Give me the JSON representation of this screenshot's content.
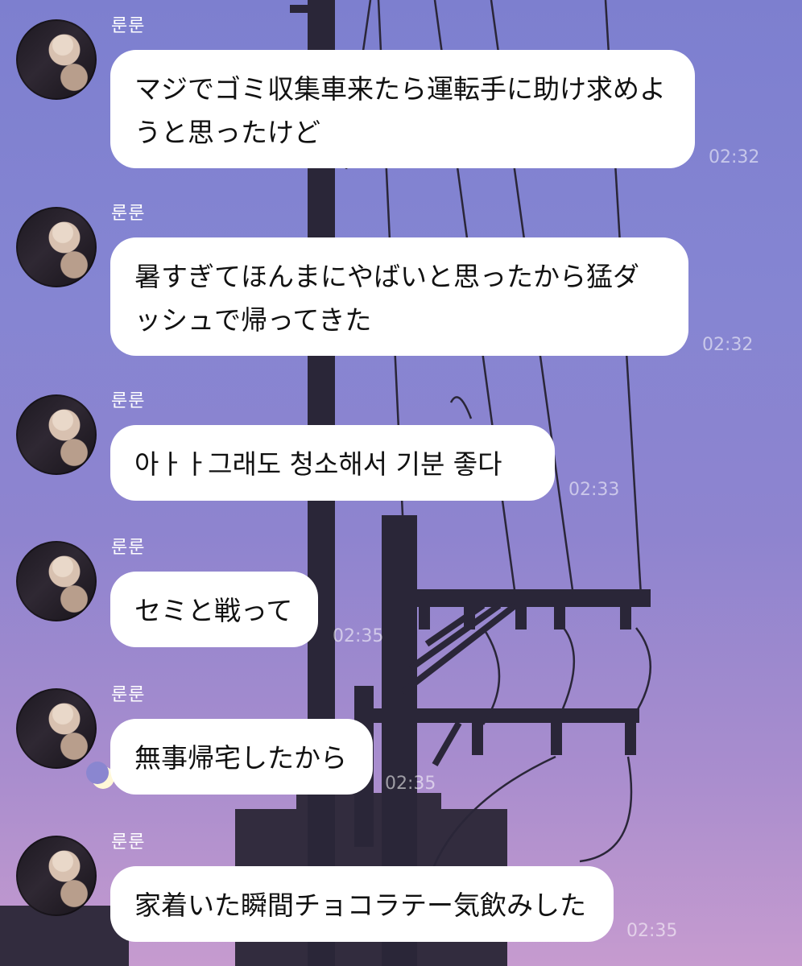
{
  "chat": {
    "messages": [
      {
        "sender": "룬룬",
        "text": "マジでゴミ収集車来たら運転手に助け求めようと思ったけど",
        "time": "02:32"
      },
      {
        "sender": "룬룬",
        "text": "暑すぎてほんまにやばいと思ったから猛ダッシュで帰ってきた",
        "time": "02:32"
      },
      {
        "sender": "룬룬",
        "text": "아ㅏㅏ그래도 청소해서 기분 좋다",
        "time": "02:33"
      },
      {
        "sender": "룬룬",
        "text": "セミと戦って",
        "time": "02:35"
      },
      {
        "sender": "룬룬",
        "text": "無事帰宅したから",
        "time": "02:35"
      },
      {
        "sender": "룬룬",
        "text": "家着いた瞬間チョコラテー気飲みした",
        "time": "02:35"
      }
    ]
  },
  "colors": {
    "sky_top": "#7d7fcf",
    "sky_bottom": "#c69bcf",
    "bubble": "#ffffff",
    "silhouette": "#2a2638"
  },
  "icons": {
    "avatar": "profile-photo-icon",
    "moon": "crescent-moon-icon"
  }
}
